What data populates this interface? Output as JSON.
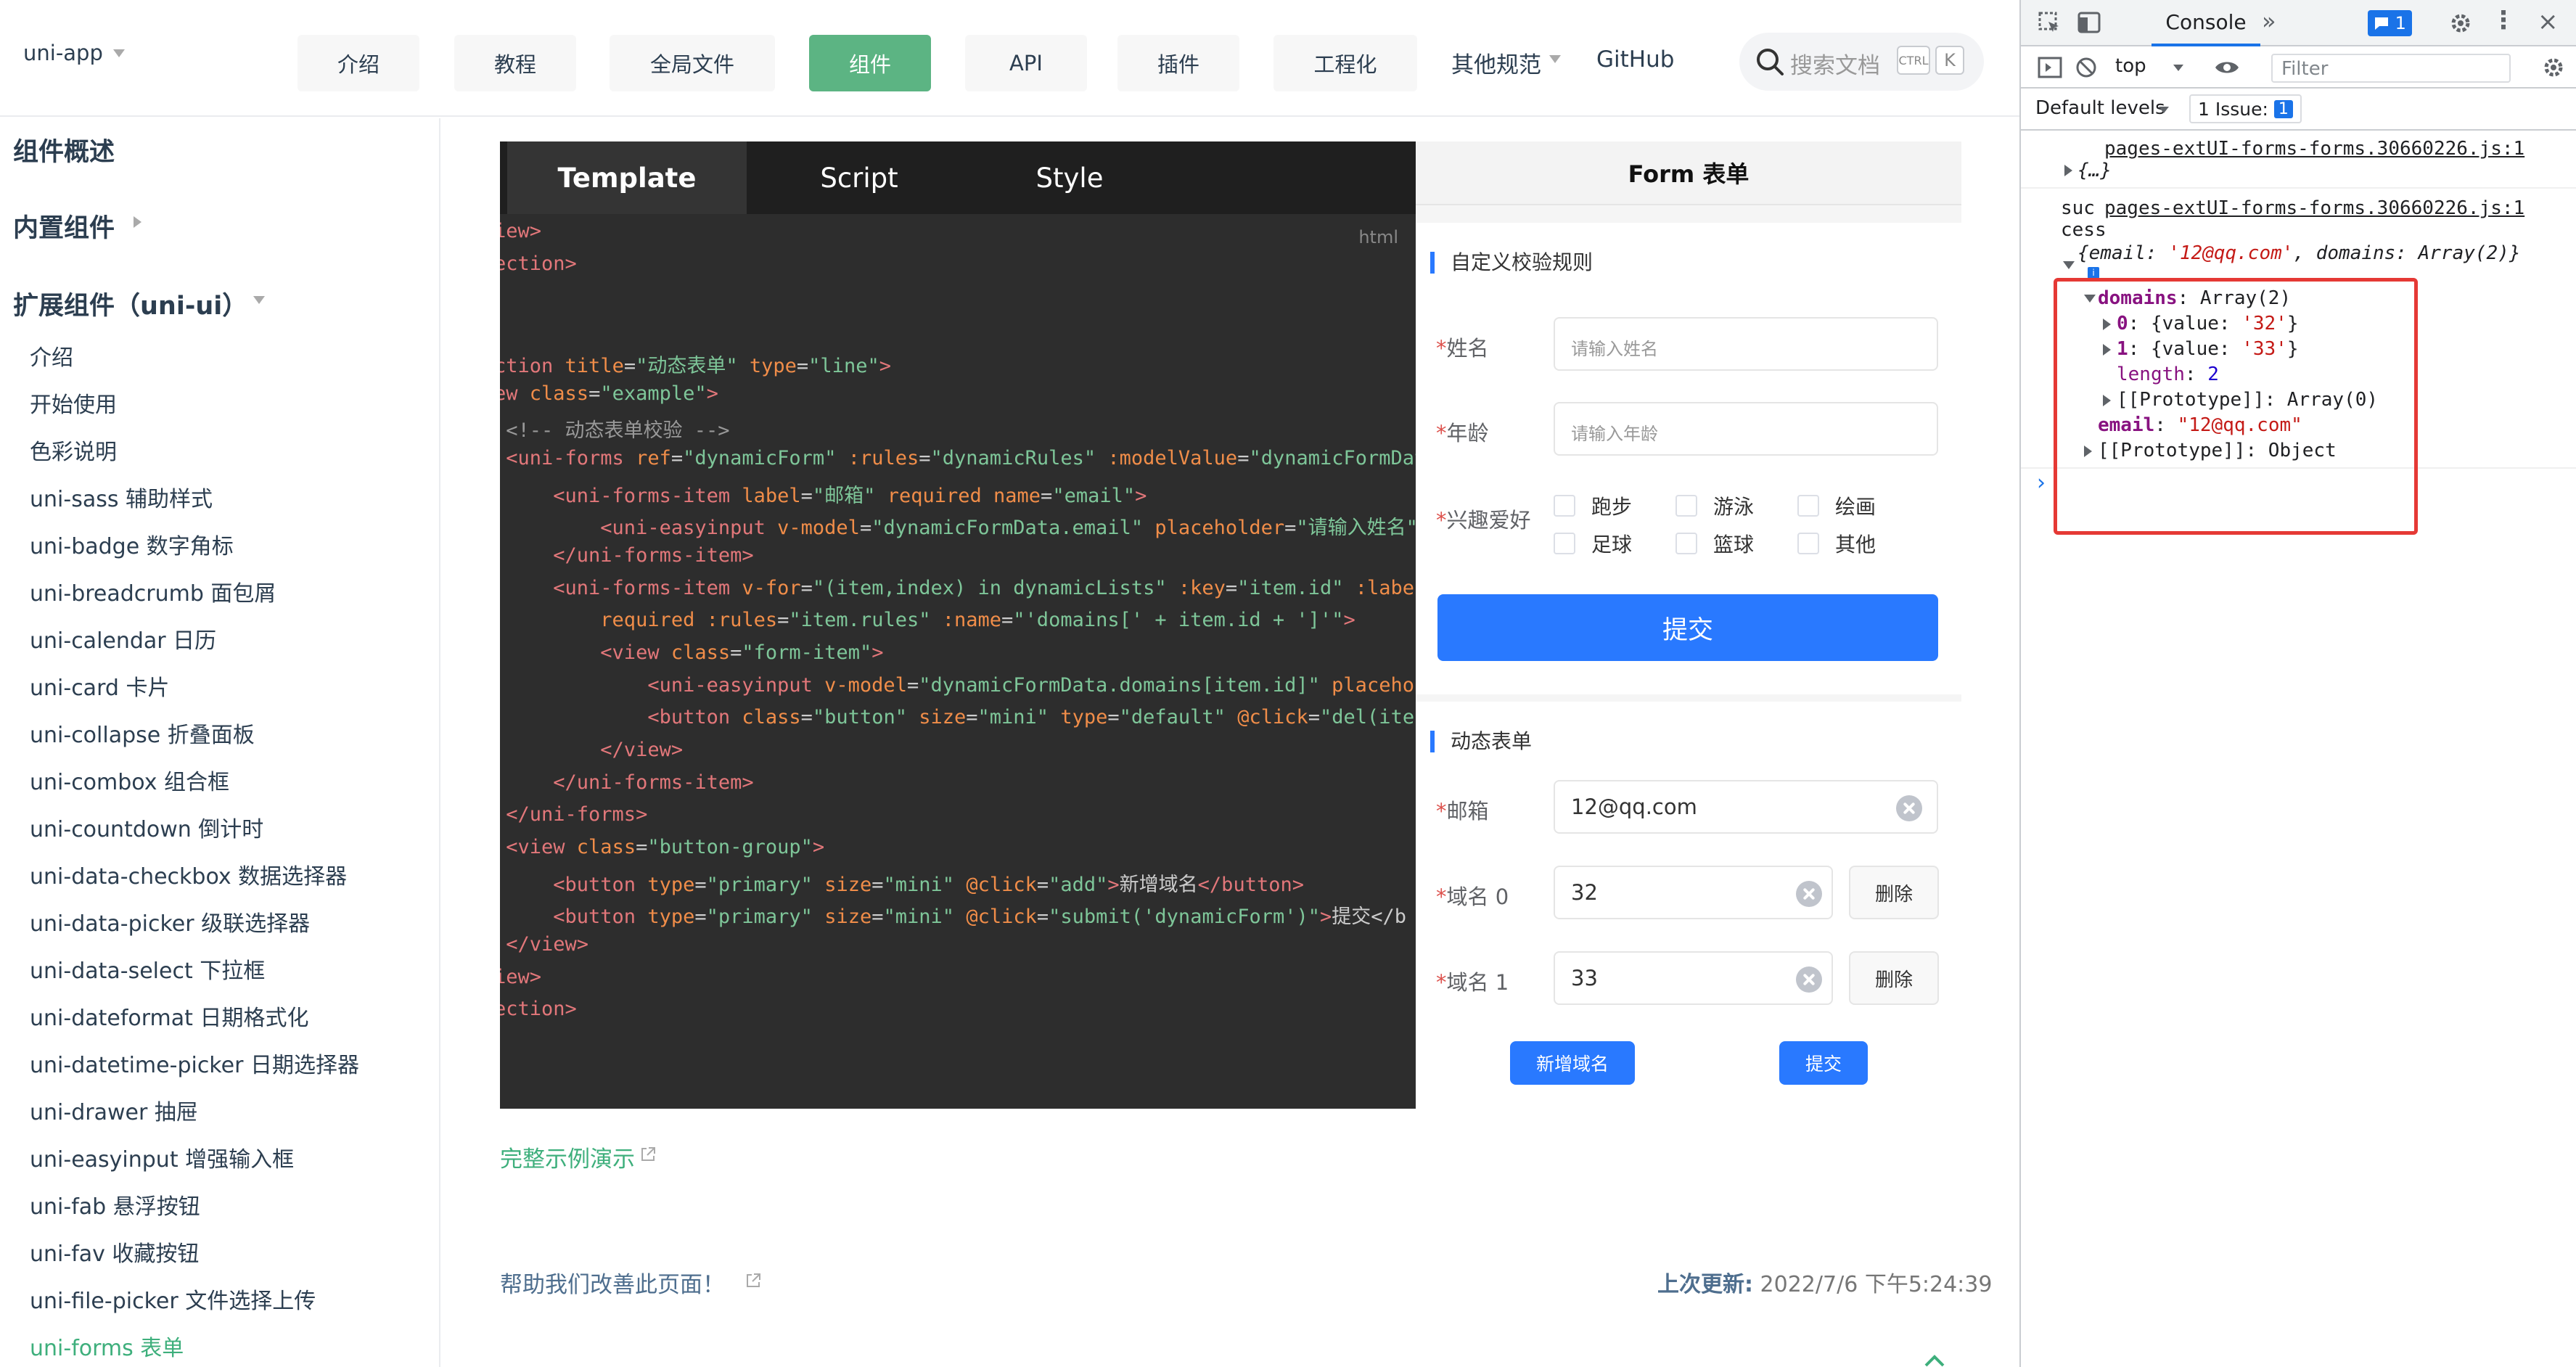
{
  "nav": {
    "brand": "uni-app",
    "items": [
      "介绍",
      "教程",
      "全局文件",
      "组件",
      "API",
      "插件",
      "工程化"
    ],
    "other": "其他规范",
    "github": "GitHub",
    "search_placeholder": "搜索文档",
    "kbd_ctrl": "CTRL",
    "kbd_k": "K"
  },
  "sidebar": {
    "headings": [
      "组件概述",
      "内置组件",
      "扩展组件（uni-ui）"
    ],
    "items": [
      "介绍",
      "开始使用",
      "色彩说明",
      "uni-sass 辅助样式",
      "uni-badge 数字角标",
      "uni-breadcrumb 面包屑",
      "uni-calendar 日历",
      "uni-card 卡片",
      "uni-collapse 折叠面板",
      "uni-combox 组合框",
      "uni-countdown 倒计时",
      "uni-data-checkbox 数据选择器",
      "uni-data-picker 级联选择器",
      "uni-data-select 下拉框",
      "uni-dateformat 日期格式化",
      "uni-datetime-picker 日期选择器",
      "uni-drawer 抽屉",
      "uni-easyinput 增强输入框",
      "uni-fab 悬浮按钮",
      "uni-fav 收藏按钮",
      "uni-file-picker 文件选择上传",
      "uni-forms 表单"
    ],
    "active_index": 21
  },
  "code": {
    "tabs": [
      "Template",
      "Script",
      "Style"
    ],
    "lang": "html"
  },
  "preview": {
    "title": "Form 表单",
    "section1": "自定义校验规则",
    "name_label": "姓名",
    "name_placeholder": "请输入姓名",
    "age_label": "年龄",
    "age_placeholder": "请输入年龄",
    "hobby_label": "兴趣爱好",
    "hobbies": [
      "跑步",
      "游泳",
      "绘画",
      "足球",
      "篮球",
      "其他"
    ],
    "submit": "提交",
    "section2": "动态表单",
    "email_label": "邮箱",
    "email_value": "12@qq.com",
    "domain0_label": "域名 0",
    "domain0_value": "32",
    "domain1_label": "域名 1",
    "domain1_value": "33",
    "delete": "删除",
    "add_domain": "新增域名",
    "submit2": "提交"
  },
  "footer": {
    "full_demo": "完整示例演示",
    "help": "帮助我们改善此页面！",
    "last_update_label": "上次更新:",
    "last_update_value": "2022/7/6 下午5:24:39"
  },
  "devtools": {
    "tab": "Console",
    "msg_badge": "1",
    "context": "top",
    "filter_placeholder": "Filter",
    "levels": "Default levels",
    "issues": "1 Issue:",
    "issues_count": "1",
    "src1": "pages-extUI-forms-forms.30660226.js:1",
    "obj1": "{…}",
    "suc1": "suc",
    "suc2": "cess",
    "src2": "pages-extUI-forms-forms.30660226.js:1"
  }
}
